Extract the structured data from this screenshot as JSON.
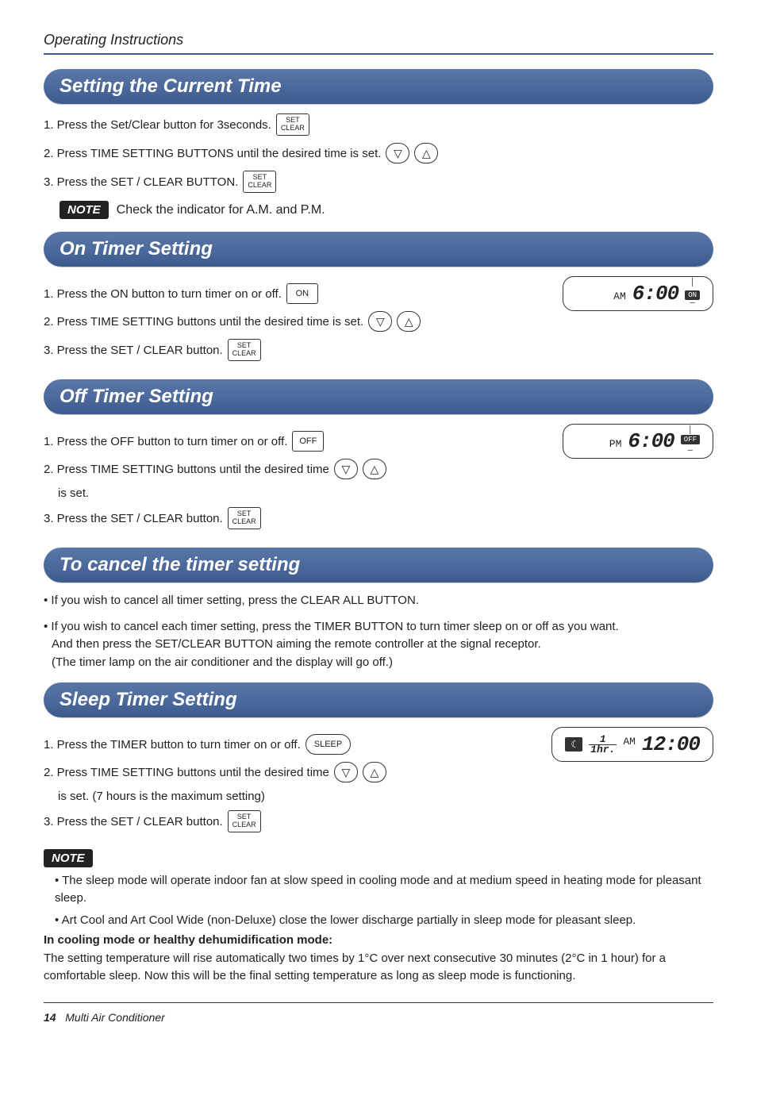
{
  "header": {
    "title": "Operating Instructions"
  },
  "sections": {
    "current_time": {
      "title": "Setting the Current Time",
      "step1": "1. Press the Set/Clear button for 3seconds.",
      "step2": "2. Press TIME SETTING BUTTONS until the desired time is set.",
      "step3": "3. Press the SET / CLEAR BUTTON.",
      "note": "Check the indicator for A.M. and P.M."
    },
    "on_timer": {
      "title": "On Timer Setting",
      "step1": "1. Press the ON button to turn timer on or off.",
      "step2": "2. Press TIME SETTING buttons until the desired time is set.",
      "step3": "3. Press the SET / CLEAR button.",
      "display": {
        "ampm": "AM",
        "time": "6:00",
        "badge": "ON"
      }
    },
    "off_timer": {
      "title": "Off Timer Setting",
      "step1": "1. Press the OFF button to turn timer on or off.",
      "step2a": "2. Press TIME SETTING buttons until the desired time",
      "step2b": "is set.",
      "step3": "3. Press the SET / CLEAR button.",
      "display": {
        "ampm": "PM",
        "time": "6:00",
        "badge": "OFF"
      }
    },
    "cancel": {
      "title": "To cancel the timer setting",
      "bullet1": "• If you wish to cancel all timer setting, press the CLEAR ALL BUTTON.",
      "bullet2": "• If you wish to cancel each timer setting, press the TIMER BUTTON to turn timer sleep on or off as you want.",
      "bullet2b": "And then press the SET/CLEAR BUTTON aiming the remote controller at the signal receptor.",
      "bullet2c": "(The timer lamp on the air conditioner and the display will go off.)"
    },
    "sleep": {
      "title": "Sleep Timer Setting",
      "step1": "1. Press the TIMER button to turn timer on or off.",
      "step2a": "2. Press TIME SETTING buttons until the desired time",
      "step2b": "is set. (7 hours is the maximum setting)",
      "step3": "3. Press the SET / CLEAR button.",
      "display": {
        "hr_top": "1",
        "hr_bot": "1hr.",
        "ampm": "AM",
        "time": "12:00"
      }
    },
    "note_bottom": {
      "label": "NOTE",
      "bullet1": "• The sleep mode will operate indoor fan at slow speed in cooling mode and at medium speed in heating mode for pleasant sleep.",
      "bullet2": "• Art Cool and Art Cool Wide (non-Deluxe) close the lower discharge partially in sleep mode for pleasant sleep.",
      "bold": "In cooling mode or healthy dehumidification mode:",
      "body": "The setting temperature will rise automatically two times by 1°C over next consecutive 30 minutes (2°C in 1 hour) for a comfortable sleep. Now this will be the final setting temperature as long as sleep mode is functioning."
    }
  },
  "buttons": {
    "set_clear_top": "SET",
    "set_clear_bot": "CLEAR",
    "down": "▽",
    "up": "△",
    "on": "ON",
    "off": "OFF",
    "sleep": "SLEEP"
  },
  "footer": {
    "page": "14",
    "product": "Multi Air Conditioner"
  }
}
